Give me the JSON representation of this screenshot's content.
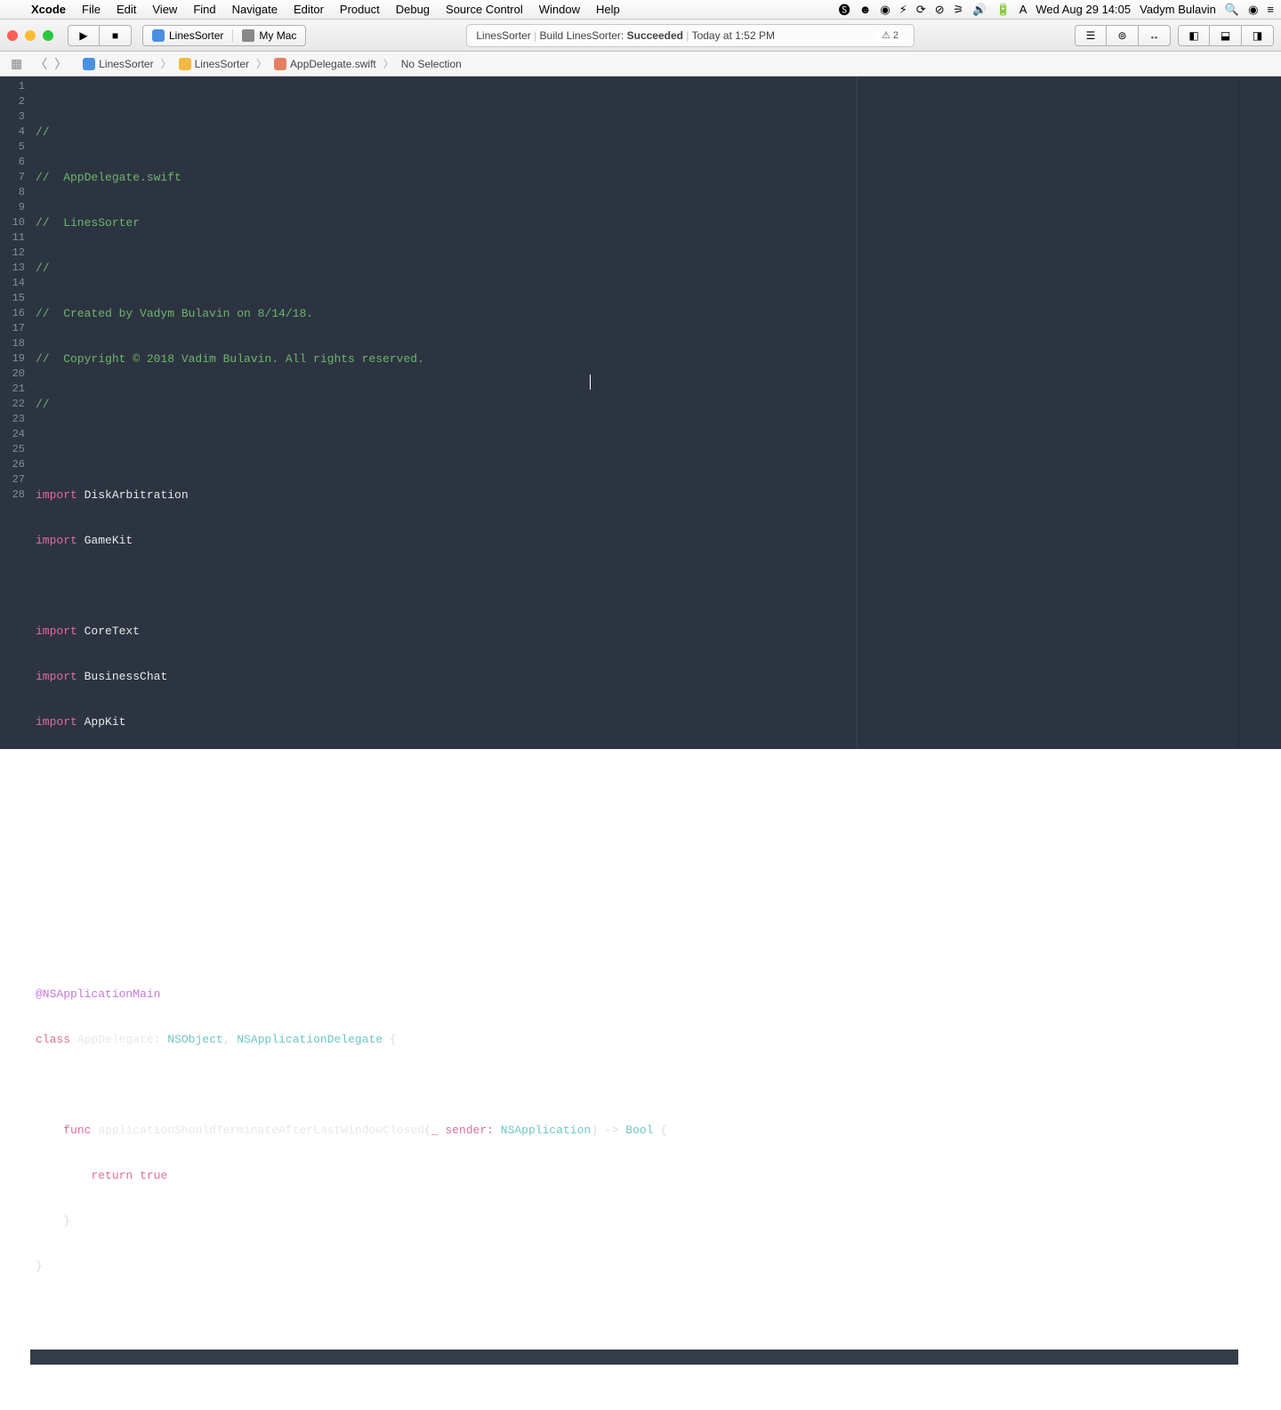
{
  "menubar": {
    "app": "Xcode",
    "items": [
      "File",
      "Edit",
      "View",
      "Find",
      "Navigate",
      "Editor",
      "Product",
      "Debug",
      "Source Control",
      "Window",
      "Help"
    ],
    "datetime": "Wed Aug 29  14:05",
    "username": "Vadym Bulavin"
  },
  "toolbar": {
    "scheme": "LinesSorter",
    "destination": "My Mac",
    "activity_scheme": "LinesSorter",
    "activity_prefix": "Build LinesSorter: ",
    "activity_status": "Succeeded",
    "activity_time": "Today at 1:52 PM",
    "warning_count": "⚠︎ 2"
  },
  "jumpbar": {
    "project": "LinesSorter",
    "folder": "LinesSorter",
    "file": "AppDelegate.swift",
    "selection": "No Selection"
  },
  "code": {
    "l1": "//",
    "l2": "//  AppDelegate.swift",
    "l3": "//  LinesSorter",
    "l4": "//",
    "l5": "//  Created by Vadym Bulavin on 8/14/18.",
    "l6": "//  Copyright © 2018 Vadim Bulavin. All rights reserved.",
    "l7": "//",
    "import": "import",
    "mod_DiskArbitration": "DiskArbitration",
    "mod_GameKit": "GameKit",
    "mod_CoreText": "CoreText",
    "mod_BusinessChat": "BusinessChat",
    "mod_AppKit": "AppKit",
    "attr": "@NSApplicationMain",
    "class_kw": "class",
    "class_name": "AppDelegate",
    "superclass": "NSObject",
    "protocol": "NSApplicationDelegate",
    "brace_open": "{",
    "func_kw": "func",
    "func_name": "applicationShouldTerminateAfterLastWindowClosed",
    "param": "_ sender:",
    "param_type": "NSApplication",
    "arrow": ") ->",
    "ret_type": "Bool",
    "brace_open2": "{",
    "return_kw": "return",
    "true_kw": "true",
    "brace_close": "}",
    "brace_close2": "}"
  }
}
